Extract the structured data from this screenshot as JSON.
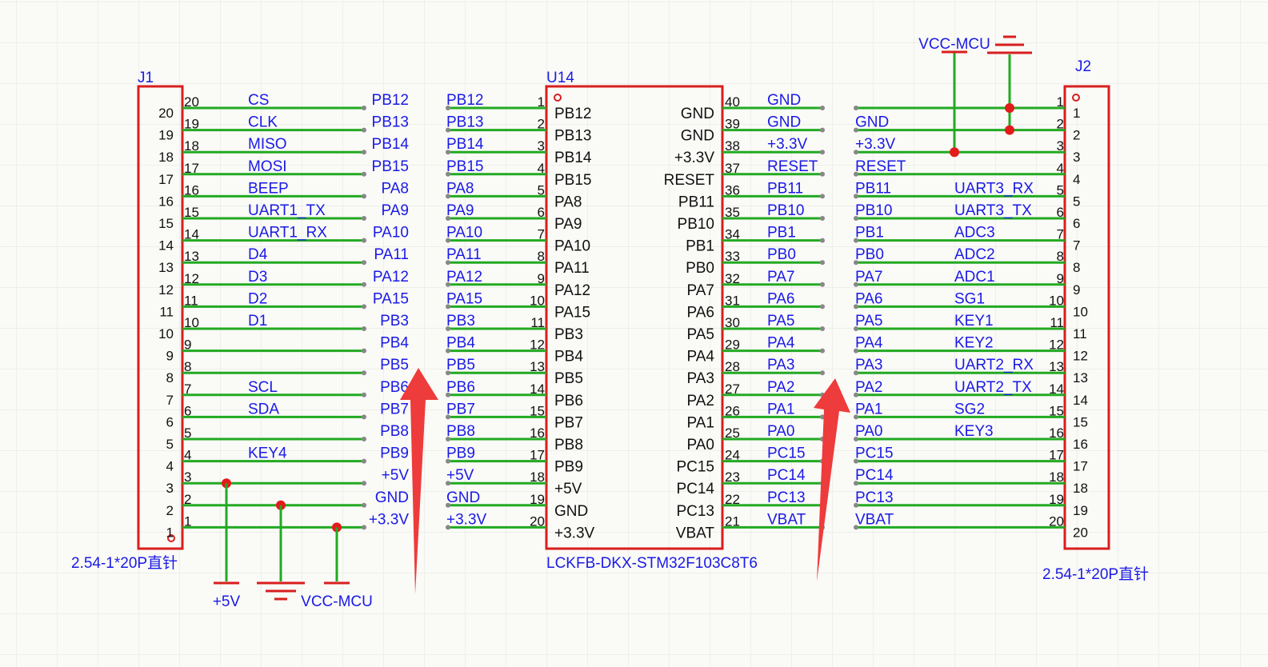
{
  "colors": {
    "wire": "#22aa22",
    "body": "#d81e1e",
    "label": "#1a1ae6",
    "text": "#111111",
    "arrow": "#ee3b3b",
    "grid": "#e3e3dc"
  },
  "j1": {
    "ref": "J1",
    "part": "2.54-1*20P直针",
    "pins": [
      {
        "pin": "20",
        "sig": "CS",
        "net": "PB12"
      },
      {
        "pin": "19",
        "sig": "CLK",
        "net": "PB13"
      },
      {
        "pin": "18",
        "sig": "MISO",
        "net": "PB14"
      },
      {
        "pin": "17",
        "sig": "MOSI",
        "net": "PB15"
      },
      {
        "pin": "16",
        "sig": "BEEP",
        "net": "PA8"
      },
      {
        "pin": "15",
        "sig": "UART1_TX",
        "net": "PA9"
      },
      {
        "pin": "14",
        "sig": "UART1_RX",
        "net": "PA10"
      },
      {
        "pin": "13",
        "sig": "D4",
        "net": "PA11"
      },
      {
        "pin": "12",
        "sig": "D3",
        "net": "PA12"
      },
      {
        "pin": "11",
        "sig": "D2",
        "net": "PA15"
      },
      {
        "pin": "10",
        "sig": "D1",
        "net": "PB3"
      },
      {
        "pin": "9",
        "sig": "",
        "net": "PB4"
      },
      {
        "pin": "8",
        "sig": "",
        "net": "PB5"
      },
      {
        "pin": "7",
        "sig": "SCL",
        "net": "PB6"
      },
      {
        "pin": "6",
        "sig": "SDA",
        "net": "PB7"
      },
      {
        "pin": "5",
        "sig": "",
        "net": "PB8"
      },
      {
        "pin": "4",
        "sig": "KEY4",
        "net": "PB9"
      },
      {
        "pin": "3",
        "sig": "",
        "net": "+5V"
      },
      {
        "pin": "2",
        "sig": "",
        "net": "GND"
      },
      {
        "pin": "1",
        "sig": "",
        "net": "+3.3V"
      }
    ],
    "power": [
      {
        "label": "+5V",
        "kind": "bar"
      },
      {
        "label": "",
        "kind": "ground"
      },
      {
        "label": "VCC-MCU",
        "kind": "bar"
      }
    ]
  },
  "u14": {
    "ref": "U14",
    "part": "LCKFB-DKX-STM32F103C8T6",
    "left": [
      {
        "pin": "1",
        "name": "PB12",
        "net": "PB12"
      },
      {
        "pin": "2",
        "name": "PB13",
        "net": "PB13"
      },
      {
        "pin": "3",
        "name": "PB14",
        "net": "PB14"
      },
      {
        "pin": "4",
        "name": "PB15",
        "net": "PB15"
      },
      {
        "pin": "5",
        "name": "PA8",
        "net": "PA8"
      },
      {
        "pin": "6",
        "name": "PA9",
        "net": "PA9"
      },
      {
        "pin": "7",
        "name": "PA10",
        "net": "PA10"
      },
      {
        "pin": "8",
        "name": "PA11",
        "net": "PA11"
      },
      {
        "pin": "9",
        "name": "PA12",
        "net": "PA12"
      },
      {
        "pin": "10",
        "name": "PA15",
        "net": "PA15"
      },
      {
        "pin": "11",
        "name": "PB3",
        "net": "PB3"
      },
      {
        "pin": "12",
        "name": "PB4",
        "net": "PB4"
      },
      {
        "pin": "13",
        "name": "PB5",
        "net": "PB5"
      },
      {
        "pin": "14",
        "name": "PB6",
        "net": "PB6"
      },
      {
        "pin": "15",
        "name": "PB7",
        "net": "PB7"
      },
      {
        "pin": "16",
        "name": "PB8",
        "net": "PB8"
      },
      {
        "pin": "17",
        "name": "PB9",
        "net": "PB9"
      },
      {
        "pin": "18",
        "name": "+5V",
        "net": "+5V"
      },
      {
        "pin": "19",
        "name": "GND",
        "net": "GND"
      },
      {
        "pin": "20",
        "name": "+3.3V",
        "net": "+3.3V"
      }
    ],
    "right": [
      {
        "pin": "40",
        "name": "GND",
        "net": "GND"
      },
      {
        "pin": "39",
        "name": "GND",
        "net": "GND"
      },
      {
        "pin": "38",
        "name": "+3.3V",
        "net": "+3.3V"
      },
      {
        "pin": "37",
        "name": "RESET",
        "net": "RESET"
      },
      {
        "pin": "36",
        "name": "PB11",
        "net": "PB11"
      },
      {
        "pin": "35",
        "name": "PB10",
        "net": "PB10"
      },
      {
        "pin": "34",
        "name": "PB1",
        "net": "PB1"
      },
      {
        "pin": "33",
        "name": "PB0",
        "net": "PB0"
      },
      {
        "pin": "32",
        "name": "PA7",
        "net": "PA7"
      },
      {
        "pin": "31",
        "name": "PA6",
        "net": "PA6"
      },
      {
        "pin": "30",
        "name": "PA5",
        "net": "PA5"
      },
      {
        "pin": "29",
        "name": "PA4",
        "net": "PA4"
      },
      {
        "pin": "28",
        "name": "PA3",
        "net": "PA3"
      },
      {
        "pin": "27",
        "name": "PA2",
        "net": "PA2"
      },
      {
        "pin": "26",
        "name": "PA1",
        "net": "PA1"
      },
      {
        "pin": "25",
        "name": "PA0",
        "net": "PA0"
      },
      {
        "pin": "24",
        "name": "PC15",
        "net": "PC15"
      },
      {
        "pin": "23",
        "name": "PC14",
        "net": "PC14"
      },
      {
        "pin": "22",
        "name": "PC13",
        "net": "PC13"
      },
      {
        "pin": "21",
        "name": "VBAT",
        "net": "VBAT"
      }
    ]
  },
  "j2": {
    "ref": "J2",
    "part": "2.54-1*20P直针",
    "power_label": "VCC-MCU",
    "pins": [
      {
        "pin": "1",
        "net": "",
        "sig": ""
      },
      {
        "pin": "2",
        "net": "GND",
        "sig": ""
      },
      {
        "pin": "3",
        "net": "+3.3V",
        "sig": ""
      },
      {
        "pin": "4",
        "net": "RESET",
        "sig": ""
      },
      {
        "pin": "5",
        "net": "PB11",
        "sig": "UART3_RX"
      },
      {
        "pin": "6",
        "net": "PB10",
        "sig": "UART3_TX"
      },
      {
        "pin": "7",
        "net": "PB1",
        "sig": "ADC3"
      },
      {
        "pin": "8",
        "net": "PB0",
        "sig": "ADC2"
      },
      {
        "pin": "9",
        "net": "PA7",
        "sig": "ADC1"
      },
      {
        "pin": "10",
        "net": "PA6",
        "sig": "SG1"
      },
      {
        "pin": "11",
        "net": "PA5",
        "sig": "KEY1"
      },
      {
        "pin": "12",
        "net": "PA4",
        "sig": "KEY2"
      },
      {
        "pin": "13",
        "net": "PA3",
        "sig": "UART2_RX"
      },
      {
        "pin": "14",
        "net": "PA2",
        "sig": "UART2_TX"
      },
      {
        "pin": "15",
        "net": "PA1",
        "sig": "SG2"
      },
      {
        "pin": "16",
        "net": "PA0",
        "sig": "KEY3"
      },
      {
        "pin": "17",
        "net": "PC15",
        "sig": ""
      },
      {
        "pin": "18",
        "net": "PC14",
        "sig": ""
      },
      {
        "pin": "19",
        "net": "PC13",
        "sig": ""
      },
      {
        "pin": "20",
        "net": "VBAT",
        "sig": ""
      }
    ]
  }
}
